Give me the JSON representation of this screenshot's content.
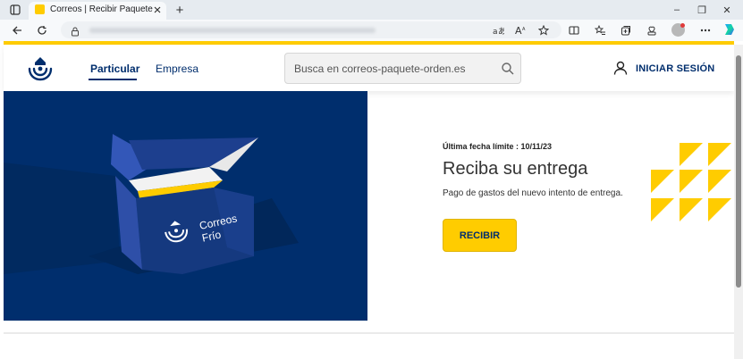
{
  "browser": {
    "tab_title": "Correos | Recibir Paquete",
    "new_tab_glyph": "+",
    "window_controls": [
      "–",
      "❐",
      "✕"
    ]
  },
  "header": {
    "nav": {
      "particular": "Particular",
      "empresa": "Empresa"
    },
    "search_placeholder": "Busca en correos-paquete-orden.es",
    "login_label": "INICIAR SESIÓN"
  },
  "hero": {
    "deadline": "Última fecha límite : 10/11/23",
    "title": "Reciba su entrega",
    "subtitle": "Pago de gastos del nuevo intento de entrega.",
    "button_label": "RECIBIR",
    "box_brand_line1": "Correos",
    "box_brand_line2": "Frío"
  },
  "colors": {
    "brand_yellow": "#ffcc00",
    "brand_blue": "#002e6d"
  },
  "icons": [
    "sidebar-toggle-icon",
    "back-icon",
    "refresh-icon",
    "lock-icon",
    "read-aloud-icon",
    "font-icon",
    "favorite-icon",
    "split-screen-icon",
    "collections-icon",
    "extensions-icon",
    "profile-icon",
    "more-icon",
    "copilot-icon",
    "search-icon",
    "user-icon"
  ]
}
